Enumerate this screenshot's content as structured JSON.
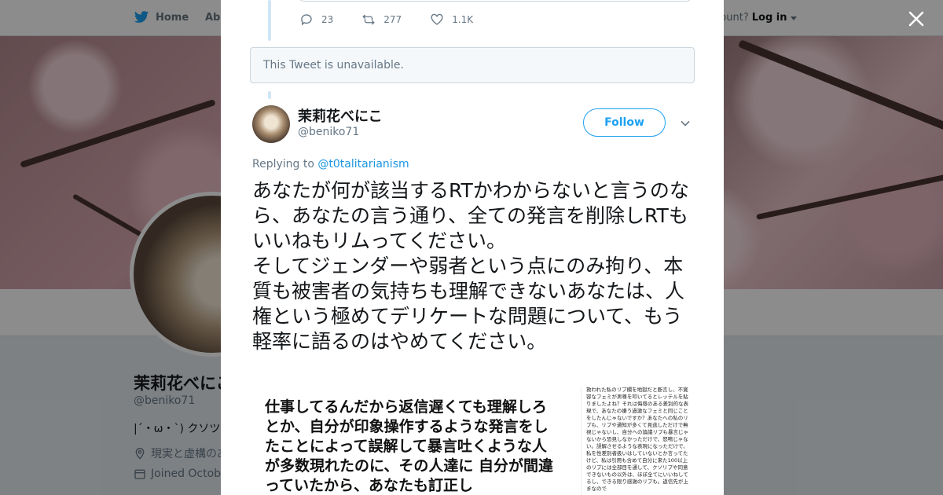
{
  "nav": {
    "home_label": "Home",
    "about_label": "Abo",
    "account_text": "ccount?",
    "login_label": "Log in"
  },
  "profile": {
    "name": "茉莉花べにこ",
    "handle": "@beniko71",
    "bio": "|´・ω・`) クソツ",
    "location": "現実と虚構のあ",
    "joined": "Joined Octobe"
  },
  "modal": {
    "actions": {
      "replies": "23",
      "retweets": "277",
      "likes": "1.1K"
    },
    "unavailable_text": "This Tweet is unavailable.",
    "tweet": {
      "author_name": "茉莉花べにこ",
      "author_handle": "@beniko71",
      "follow_label": "Follow",
      "replying_prefix": "Replying to ",
      "replying_to": "@t0talitarianism",
      "text": "あなたが何が該当するRTかわからないと言うのなら、あなたの言う通り、全ての発言を削除しRTもいいねもリムってください。\nそしてジェンダーや弱者という点にのみ拘り、本質も被害者の気持ちも理解できないあなたは、人権という極めてデリケートな問題について、もう軽率に語るのはやめてください。",
      "image_left_text": "仕事してるんだから返信遅くても理解しろとか、自分が印象操作するような発言をしたことによって誤解して暴言吐くような人が多数現れたのに、その人達に 自分が間違っていたから、あなたも訂正し",
      "image_right_text": "救われた私のリプ欄を地獄だと断言し、不寛容なフェミが男尊を叩いてるとレッテルを貼りましたよね？それは侮辱のある差別的な表現で、あなたの嫌う過激なフェミと同じことをしたんじゃないですか？あなたへの私のリプも、リプや通知が多くて見逃しただけで無視じゃないし、自分への論議リプも暴言じゃないから恐見しなかっただけで、怒鳴じゃない。誤解させるような表現になっただけで、私を性差別者扱いはしていないとか言ってたけど、私は引用も含めて自分に来た100以上のリプには全部目を通して、クソリプや同意できないもの以外は、ほぼ全てにいいねしてるし、できる限り感謝のリプも。返信先が上まなので"
    }
  },
  "colors": {
    "accent": "#1da1f2",
    "link": "#1b95e0",
    "muted": "#657786",
    "thread": "#cfe6f6"
  }
}
